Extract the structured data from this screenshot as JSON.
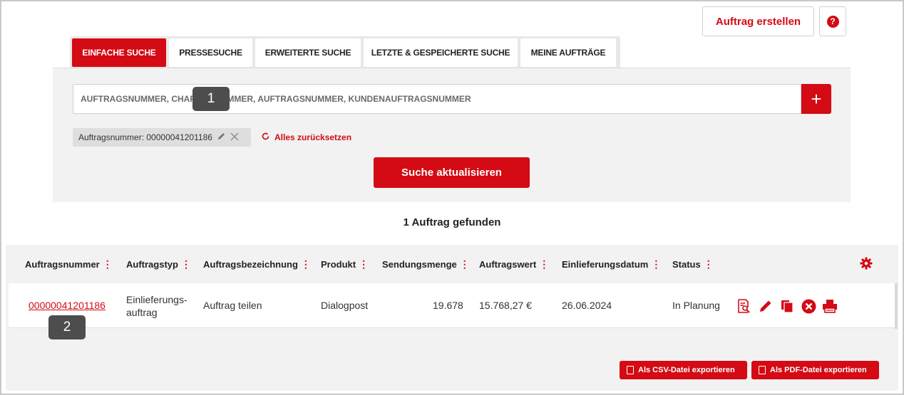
{
  "header": {
    "create_label": "Auftrag erstellen",
    "help_icon": "question-circle-icon",
    "help_glyph": "?"
  },
  "tabs": [
    {
      "label": "EINFACHE SUCHE",
      "active": true
    },
    {
      "label": "PRESSESUCHE",
      "active": false
    },
    {
      "label": "ERWEITERTE SUCHE",
      "active": false
    },
    {
      "label": "LETZTE & GESPEICHERTE SUCHE",
      "active": false
    },
    {
      "label": "MEINE AUFTRÄGE",
      "active": false
    }
  ],
  "search": {
    "placeholder": "AUFTRAGSNUMMER, CHARGENNUMMER, AUFTRAGSNUMMER, KUNDENAUFTRAGSNUMMER",
    "add_glyph": "+",
    "filter_chip": "Auftragsnummer: 00000041201186",
    "reset_label": "Alles zurücksetzen",
    "update_label": "Suche aktualisieren"
  },
  "markers": [
    "1",
    "2"
  ],
  "results": {
    "count_label": "1 Auftrag gefunden",
    "columns": [
      "Auftragsnummer",
      "Auftragstyp",
      "Auftragsbezeichnung",
      "Produkt",
      "Sendungsmenge",
      "Auftragswert",
      "Einlieferungsdatum",
      "Status"
    ],
    "rows": [
      {
        "auftragsnummer": "00000041201186",
        "auftragstyp_line1": "Einlieferungs-",
        "auftragstyp_line2": "auftrag",
        "bezeichnung": "Auftrag teilen",
        "produkt": "Dialogpost",
        "sendungsmenge": "19.678",
        "auftragswert": "15.768,27 €",
        "einlieferungsdatum": "26.06.2024",
        "status": "In Planung"
      }
    ]
  },
  "export": {
    "csv_label": "Als CSV-Datei exportieren",
    "pdf_label": "Als PDF-Datei exportieren"
  },
  "colors": {
    "accent": "#d40a14",
    "panel": "#f2f2f2"
  }
}
